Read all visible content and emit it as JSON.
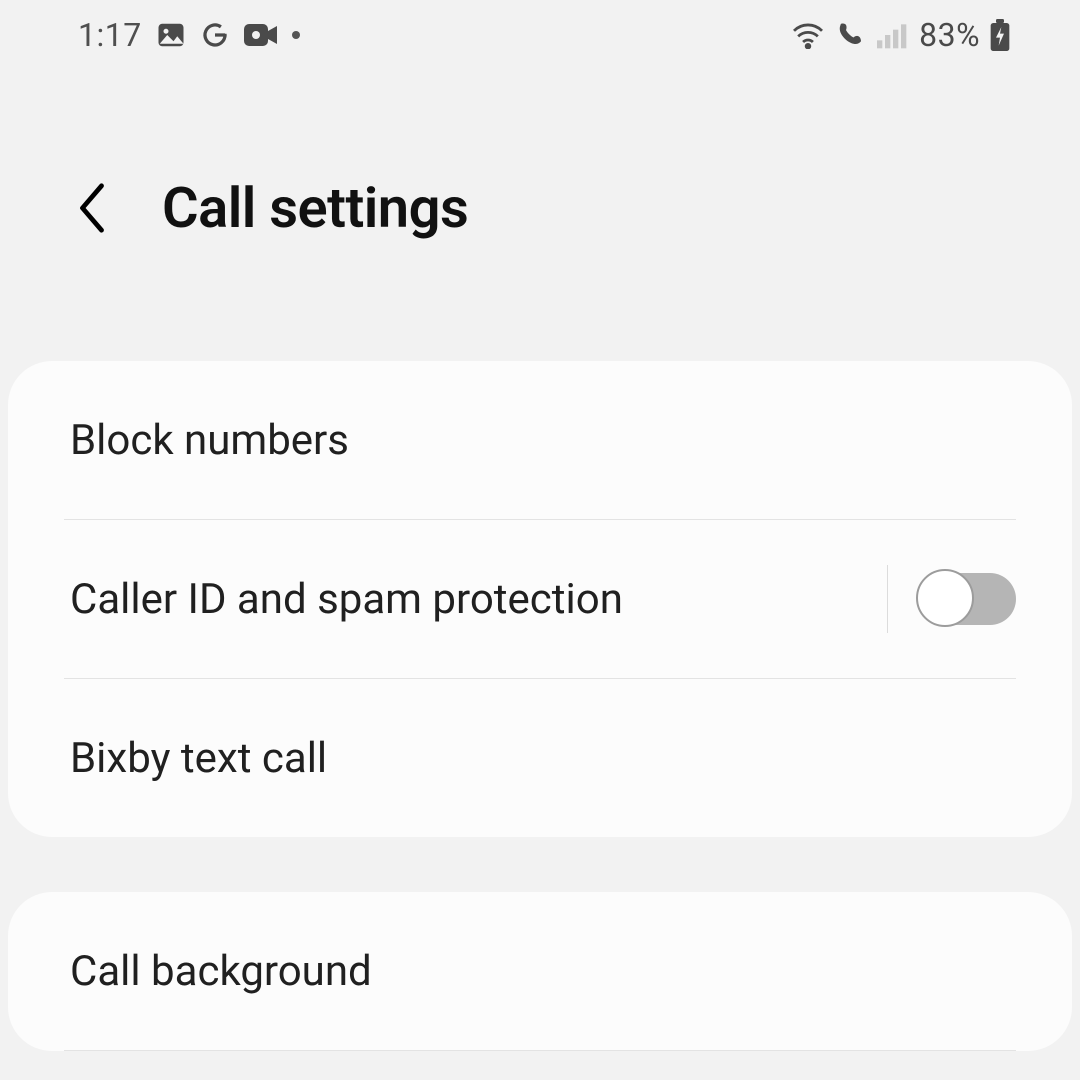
{
  "status": {
    "time": "1:17",
    "battery_pct": "83%"
  },
  "header": {
    "title": "Call settings"
  },
  "group1": {
    "items": [
      {
        "label": "Block numbers"
      },
      {
        "label": "Caller ID and spam protection",
        "toggle": false
      },
      {
        "label": "Bixby text call"
      }
    ]
  },
  "group2": {
    "items": [
      {
        "label": "Call background"
      }
    ]
  }
}
